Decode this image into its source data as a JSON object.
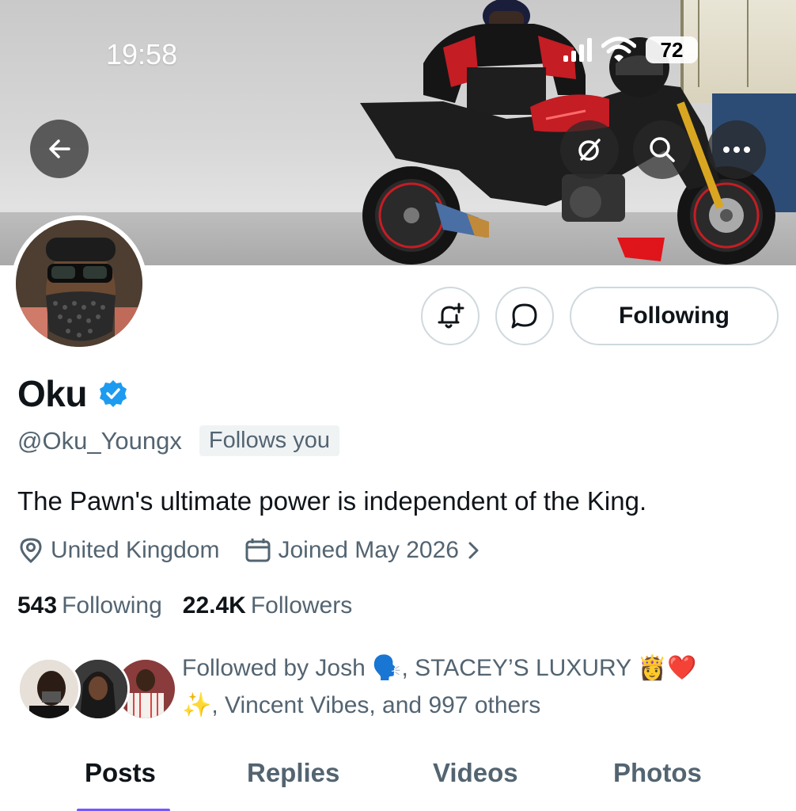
{
  "status_bar": {
    "time": "19:58",
    "battery": "72"
  },
  "header": {
    "back_icon": "arrow-left-icon",
    "grok_icon": "grok-icon",
    "search_icon": "search-icon",
    "more_icon": "more-icon"
  },
  "actions": {
    "notify_icon": "bell-plus-icon",
    "message_icon": "message-icon",
    "following_label": "Following"
  },
  "profile": {
    "name": "Oku",
    "verified": true,
    "handle": "@Oku_Youngx",
    "follows_you": "Follows you",
    "bio": "The Pawn's ultimate power is independent of the King.",
    "location": "United Kingdom",
    "joined": "Joined May 2026"
  },
  "stats": {
    "following_count": "543",
    "following_label": "Following",
    "followers_count": "22.4K",
    "followers_label": "Followers"
  },
  "followed_by": {
    "part1": "Followed by Josh 🗣️, STACEY’S LUXURY 👸❤️",
    "part2": "✨, Vincent Vibes, and 997 others"
  },
  "tabs": [
    "Posts",
    "Replies",
    "Videos",
    "Photos"
  ],
  "active_tab": "Posts",
  "colors": {
    "accent": "#7856ff",
    "verified": "#1d9bf0",
    "secondary_text": "#536471"
  }
}
